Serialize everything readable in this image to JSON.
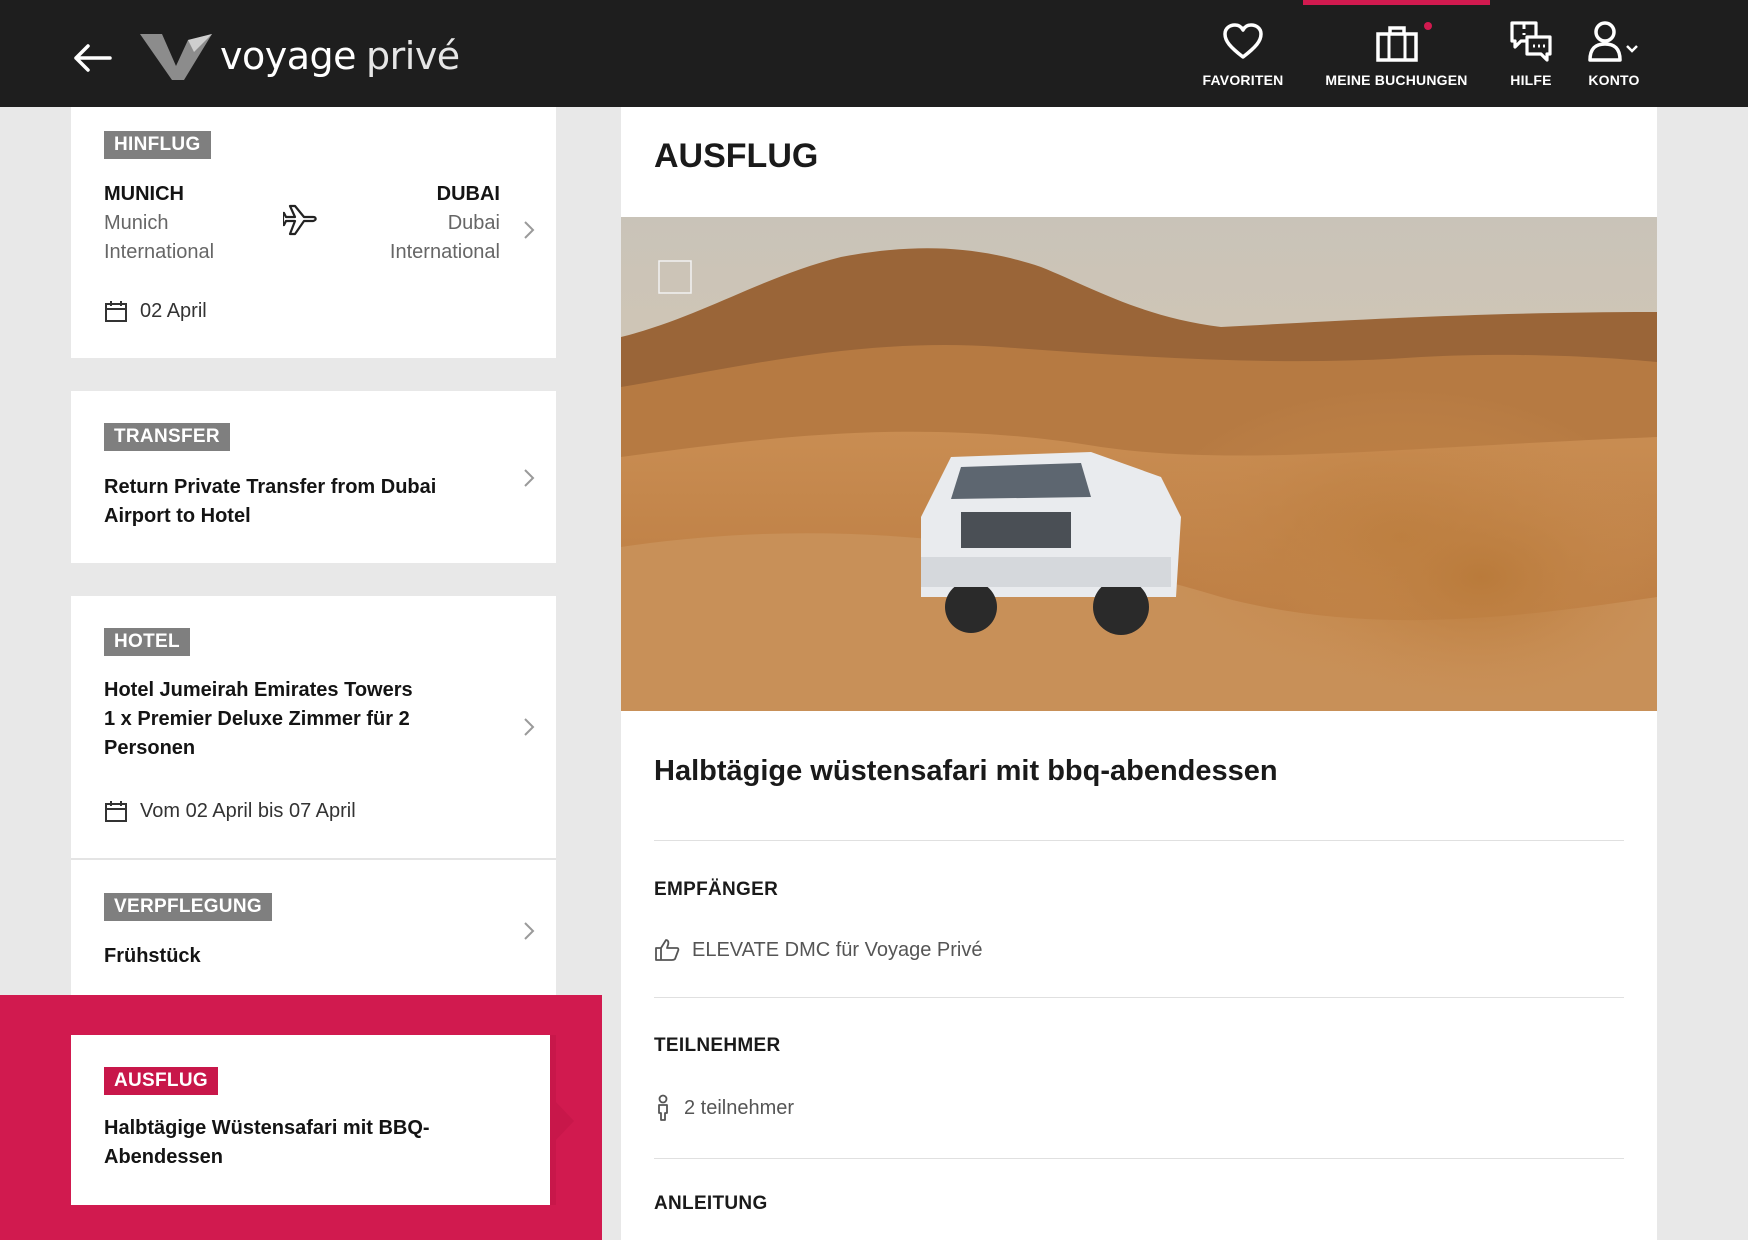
{
  "header": {
    "logo": {
      "bold": "voyage",
      "light": "privé"
    },
    "nav": {
      "favorites": "FAVORITEN",
      "bookings": "MEINE BUCHUNGEN",
      "help": "HILFE",
      "account": "KONTO"
    },
    "accent_color": "#d11a4f"
  },
  "sidebar": {
    "outbound": {
      "tag": "HINFLUG",
      "from_code": "MUNICH",
      "from_line1": "Munich",
      "from_line2": "International",
      "to_code": "DUBAI",
      "to_line1": "Dubai",
      "to_line2": "International",
      "date": "02 April"
    },
    "transfer": {
      "tag": "TRANSFER",
      "line1": "Return Private Transfer from Dubai",
      "line2": "Airport to Hotel"
    },
    "hotel": {
      "tag": "HOTEL",
      "line1": "Hotel Jumeirah Emirates Towers",
      "line2": "1 x Premier Deluxe Zimmer für 2",
      "line3": "Personen",
      "dates": "Vom 02 April bis 07 April"
    },
    "meals": {
      "tag": "VERPFLEGUNG",
      "value": "Frühstück"
    },
    "excursion": {
      "tag": "AUSFLUG",
      "line1": "Halbtägige Wüstensafari mit BBQ-",
      "line2": "Abendessen"
    }
  },
  "detail": {
    "title": "AUSFLUG",
    "image_icon": "image-placeholder-icon",
    "excursion_name": "Halbtägige wüstensafari mit bbq-abendessen",
    "recipient_heading": "EMPFÄNGER",
    "recipient_value": "ELEVATE DMC für Voyage Privé",
    "participants_heading": "TEILNEHMER",
    "participants_value": "2 teilnehmer",
    "instructions_heading": "ANLEITUNG"
  }
}
